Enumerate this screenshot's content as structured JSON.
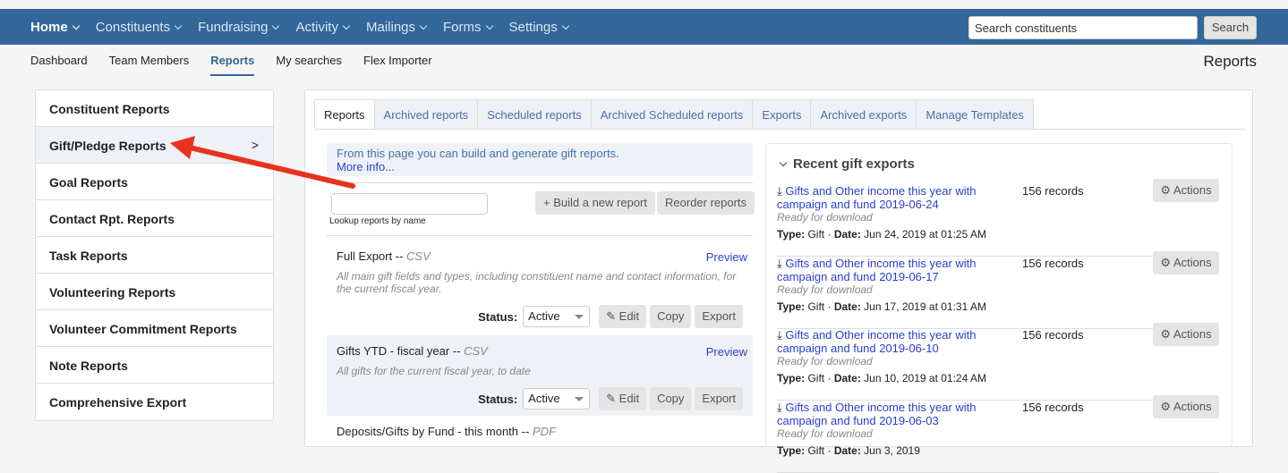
{
  "topnav": {
    "items": [
      "Home",
      "Constituents",
      "Fundraising",
      "Activity",
      "Mailings",
      "Forms",
      "Settings"
    ],
    "search_placeholder": "Search constituents",
    "search_button": "Search"
  },
  "subnav": {
    "items": [
      "Dashboard",
      "Team Members",
      "Reports",
      "My searches",
      "Flex Importer"
    ],
    "page_title": "Reports"
  },
  "sidebar": {
    "items": [
      "Constituent Reports",
      "Gift/Pledge Reports",
      "Goal Reports",
      "Contact Rpt. Reports",
      "Task Reports",
      "Volunteering Reports",
      "Volunteer Commitment Reports",
      "Note Reports",
      "Comprehensive Export"
    ],
    "arrow": ">"
  },
  "tabs": [
    "Reports",
    "Archived reports",
    "Scheduled reports",
    "Archived Scheduled reports",
    "Exports",
    "Archived exports",
    "Manage Templates"
  ],
  "info": {
    "text": "From this page you can build and generate gift reports.",
    "link": "More info..."
  },
  "lookup_label": "Lookup reports by name",
  "buttons": {
    "build": "+ Build a new report",
    "reorder": "Reorder reports"
  },
  "reports": [
    {
      "name": "Full Export --",
      "format": "CSV",
      "preview": "Preview",
      "desc": "All main gift fields and types, including constituent name and contact information, for the current fiscal year.",
      "status_label": "Status:",
      "status": "Active",
      "edit": "✎ Edit",
      "copy": "Copy",
      "export": "Export"
    },
    {
      "name": "Gifts YTD - fiscal year --",
      "format": "CSV",
      "preview": "Preview",
      "desc": "All gifts for the current fiscal year, to date",
      "status_label": "Status:",
      "status": "Active",
      "edit": "✎ Edit",
      "copy": "Copy",
      "export": "Export"
    },
    {
      "name": "Deposits/Gifts by Fund - this month --",
      "format": "PDF"
    }
  ],
  "recent": {
    "title": "Recent gift exports",
    "items": [
      {
        "name": "Gifts and Other income this year with campaign and fund 2019-06-24",
        "status": "Ready for download",
        "type": "Gift",
        "date": "Jun 24, 2019 at 01:25 AM",
        "records": "156 records",
        "actions": "Actions"
      },
      {
        "name": "Gifts and Other income this year with campaign and fund 2019-06-17",
        "status": "Ready for download",
        "type": "Gift",
        "date": "Jun 17, 2019 at 01:31 AM",
        "records": "156 records",
        "actions": "Actions"
      },
      {
        "name": "Gifts and Other income this year with campaign and fund 2019-06-10",
        "status": "Ready for download",
        "type": "Gift",
        "date": "Jun 10, 2019 at 01:24 AM",
        "records": "156 records",
        "actions": "Actions"
      },
      {
        "name": "Gifts and Other income this year with campaign and fund 2019-06-03",
        "status": "Ready for download",
        "type": "Gift",
        "date": "Jun 3, 2019",
        "records": "156 records",
        "actions": "Actions"
      }
    ],
    "type_label": "Type:",
    "date_label": "Date:"
  },
  "colors": {
    "nav": "#33679a",
    "link": "#2a3fcf",
    "arrow": "#e8321e"
  }
}
